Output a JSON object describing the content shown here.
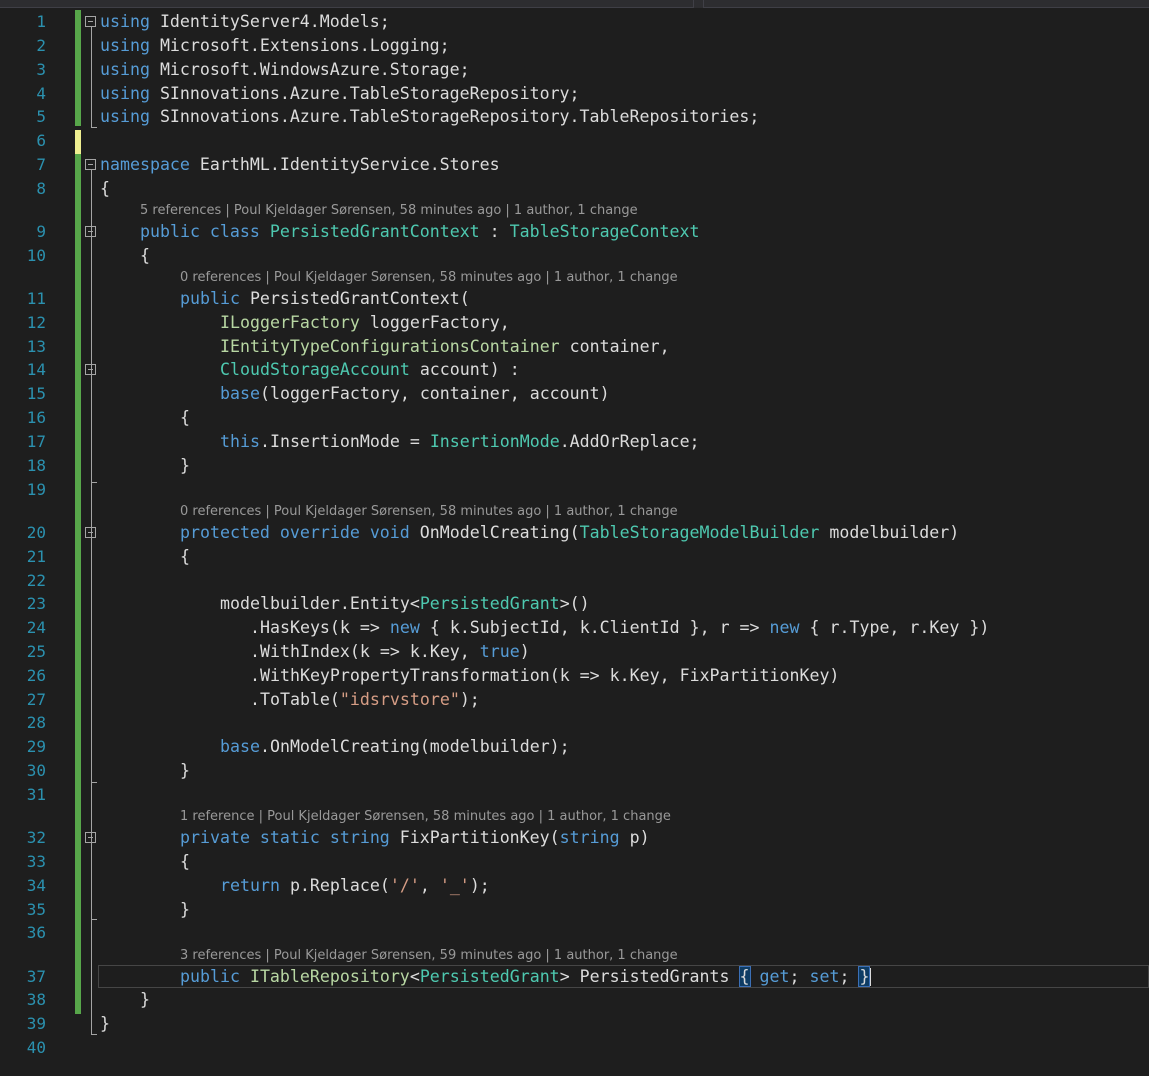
{
  "editor": {
    "line_numbers": [
      "1",
      "2",
      "3",
      "4",
      "5",
      "6",
      "7",
      "8",
      "9",
      "10",
      "11",
      "12",
      "13",
      "14",
      "15",
      "16",
      "17",
      "18",
      "19",
      "20",
      "21",
      "22",
      "23",
      "24",
      "25",
      "26",
      "27",
      "28",
      "29",
      "30",
      "31",
      "32",
      "33",
      "34",
      "35",
      "36",
      "37",
      "38",
      "39",
      "40"
    ],
    "codelens": {
      "class": "5 references | Poul Kjeldager Sørensen, 58 minutes ago | 1 author, 1 change",
      "ctor": "0 references | Poul Kjeldager Sørensen, 58 minutes ago | 1 author, 1 change",
      "onmodel": "0 references | Poul Kjeldager Sørensen, 58 minutes ago | 1 author, 1 change",
      "fixkey": "1 reference | Poul Kjeldager Sørensen, 58 minutes ago | 1 author, 1 change",
      "prop": "3 references | Poul Kjeldager Sørensen, 59 minutes ago | 1 author, 1 change"
    },
    "lines": {
      "l1": [
        [
          "kw",
          "using"
        ],
        [
          "pl",
          " IdentityServer4.Models;"
        ]
      ],
      "l2": [
        [
          "kw",
          "using"
        ],
        [
          "pl",
          " Microsoft.Extensions.Logging;"
        ]
      ],
      "l3": [
        [
          "kw",
          "using"
        ],
        [
          "pl",
          " Microsoft.WindowsAzure.Storage;"
        ]
      ],
      "l4": [
        [
          "kw",
          "using"
        ],
        [
          "pl",
          " SInnovations.Azure.TableStorageRepository;"
        ]
      ],
      "l5": [
        [
          "kw",
          "using"
        ],
        [
          "pl",
          " SInnovations.Azure.TableStorageRepository.TableRepositories;"
        ]
      ],
      "l7": [
        [
          "kw",
          "namespace"
        ],
        [
          "pl",
          " EarthML.IdentityService.Stores"
        ]
      ],
      "l8": [
        [
          "pl",
          "{"
        ]
      ],
      "l9": [
        [
          "kw",
          "public class "
        ],
        [
          "ty",
          "PersistedGrantContext"
        ],
        [
          "pl",
          " : "
        ],
        [
          "ty",
          "TableStorageContext"
        ]
      ],
      "l10": [
        [
          "pl",
          "{"
        ]
      ],
      "l11": [
        [
          "kw",
          "public"
        ],
        [
          "pl",
          " PersistedGrantContext("
        ]
      ],
      "l12": [
        [
          "if",
          "ILoggerFactory"
        ],
        [
          "pl",
          " loggerFactory,"
        ]
      ],
      "l13": [
        [
          "if",
          "IEntityTypeConfigurationsContainer"
        ],
        [
          "pl",
          " container,"
        ]
      ],
      "l14": [
        [
          "ty",
          "CloudStorageAccount"
        ],
        [
          "pl",
          " account) :"
        ]
      ],
      "l15": [
        [
          "kw",
          "base"
        ],
        [
          "pl",
          "(loggerFactory, container, account)"
        ]
      ],
      "l16": [
        [
          "pl",
          "{"
        ]
      ],
      "l17": [
        [
          "kw",
          "this"
        ],
        [
          "pl",
          ".InsertionMode = "
        ],
        [
          "ty",
          "InsertionMode"
        ],
        [
          "pl",
          ".AddOrReplace;"
        ]
      ],
      "l18": [
        [
          "pl",
          "}"
        ]
      ],
      "l20": [
        [
          "kw",
          "protected override void"
        ],
        [
          "pl",
          " OnModelCreating("
        ],
        [
          "ty",
          "TableStorageModelBuilder"
        ],
        [
          "pl",
          " modelbuilder)"
        ]
      ],
      "l21": [
        [
          "pl",
          "{"
        ]
      ],
      "l23": [
        [
          "pl",
          "modelbuilder.Entity<"
        ],
        [
          "ty",
          "PersistedGrant"
        ],
        [
          "pl",
          ">()"
        ]
      ],
      "l24": [
        [
          "pl",
          ".HasKeys(k => "
        ],
        [
          "kw",
          "new"
        ],
        [
          "pl",
          " { k.SubjectId, k.ClientId }, r => "
        ],
        [
          "kw",
          "new"
        ],
        [
          "pl",
          " { r.Type, r.Key })"
        ]
      ],
      "l25": [
        [
          "pl",
          ".WithIndex(k => k.Key, "
        ],
        [
          "kw",
          "true"
        ],
        [
          "pl",
          ")"
        ]
      ],
      "l26": [
        [
          "pl",
          ".WithKeyPropertyTransformation(k => k.Key, FixPartitionKey)"
        ]
      ],
      "l27": [
        [
          "pl",
          ".ToTable("
        ],
        [
          "st",
          "\"idsrvstore\""
        ],
        [
          "pl",
          ");"
        ]
      ],
      "l29": [
        [
          "kw",
          "base"
        ],
        [
          "pl",
          ".OnModelCreating(modelbuilder);"
        ]
      ],
      "l30": [
        [
          "pl",
          "}"
        ]
      ],
      "l32": [
        [
          "kw",
          "private static string"
        ],
        [
          "pl",
          " FixPartitionKey("
        ],
        [
          "kw",
          "string"
        ],
        [
          "pl",
          " p)"
        ]
      ],
      "l33": [
        [
          "pl",
          "{"
        ]
      ],
      "l34": [
        [
          "kw",
          "return"
        ],
        [
          "pl",
          " p.Replace("
        ],
        [
          "st",
          "'/'"
        ],
        [
          "pl",
          ", "
        ],
        [
          "st",
          "'_'"
        ],
        [
          "pl",
          ");"
        ]
      ],
      "l35": [
        [
          "pl",
          "}"
        ]
      ],
      "l37": [
        [
          "kw",
          "public"
        ],
        [
          "pl",
          " "
        ],
        [
          "if",
          "ITableRepository"
        ],
        [
          "pl",
          "<"
        ],
        [
          "ty",
          "PersistedGrant"
        ],
        [
          "pl",
          "> PersistedGrants "
        ],
        [
          "hl",
          "{"
        ],
        [
          "pl",
          " "
        ],
        [
          "kw",
          "get"
        ],
        [
          "pl",
          "; "
        ],
        [
          "kw",
          "set"
        ],
        [
          "pl",
          "; "
        ],
        [
          "hl",
          "}"
        ]
      ],
      "l38": [
        [
          "pl",
          "}"
        ]
      ],
      "l39": [
        [
          "pl",
          "}"
        ]
      ]
    }
  },
  "colors": {
    "background": "#1e1e1e",
    "line_number": "#2b91af",
    "keyword": "#569cd6",
    "type": "#4ec9b0",
    "interface": "#b8d7a3",
    "string": "#d69d85",
    "change_saved": "#57a64a",
    "change_unsaved": "#efef91"
  }
}
